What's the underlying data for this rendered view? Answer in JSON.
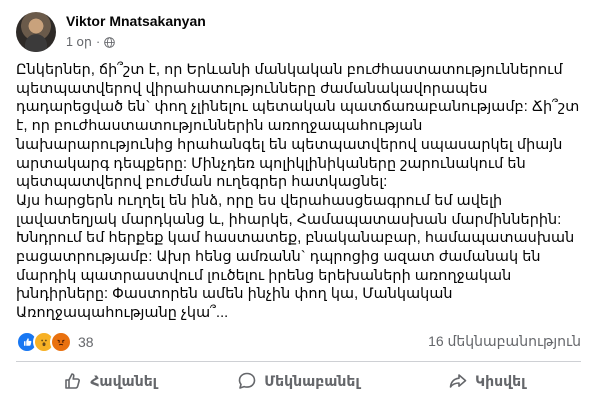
{
  "post": {
    "author": "Viktor Mnatsakanyan",
    "time": "1 օր",
    "separator": "·",
    "paragraphs": [
      "Ընկերներ, ճի՞շտ է, որ Երևանի մանկական բուժհաստատություններում պետպատվերով վիրահատությունները ժամանակավորապես դադարեցված են` փող չլինելու պետական պատճառաբանությամբ: Ճի՞շտ է, որ բուժհաստատություններին առողջապահության նախարարությունից հրահանգել են պետպատվերով սպասարկել միայն արտակարգ դեպքերը: Մինչդեռ պոլիկլինիկաները շարունակում են պետպատվերով բուժման ուղեգրեր հատկացնել:",
      "Այս հարցերն ուղղել են ինձ, որը ես վերահասցեագրում եմ ավելի լավատեղյակ մարդկանց և, իհարկե, Համապատասխան մարմիններին: Խնդրում եմ հերքեք կամ հաստատեք, բնականաբար, համապատասխան բացատրությամբ: Ախր հենց ամռանն` դպրոցից ազատ ժամանակ են մարդիկ պատրաստվում լուծելու իրենց երեխաների առողջական խնդիրները: Փաստորեն ամեն ինչին փող կա, Մանկական Առողջապահությանը չկա՞..."
    ]
  },
  "reactions": {
    "types": [
      "like",
      "wow",
      "angry"
    ],
    "count": "38",
    "comments": "16 մեկնաբանություն"
  },
  "actions": {
    "like": "Հավանել",
    "comment": "Մեկնաբանել",
    "share": "Կիսվել"
  },
  "colors": {
    "like": "#1877f2",
    "wow": "#f7b125",
    "angry": "#e9710f",
    "secondary_text": "#65676b"
  }
}
